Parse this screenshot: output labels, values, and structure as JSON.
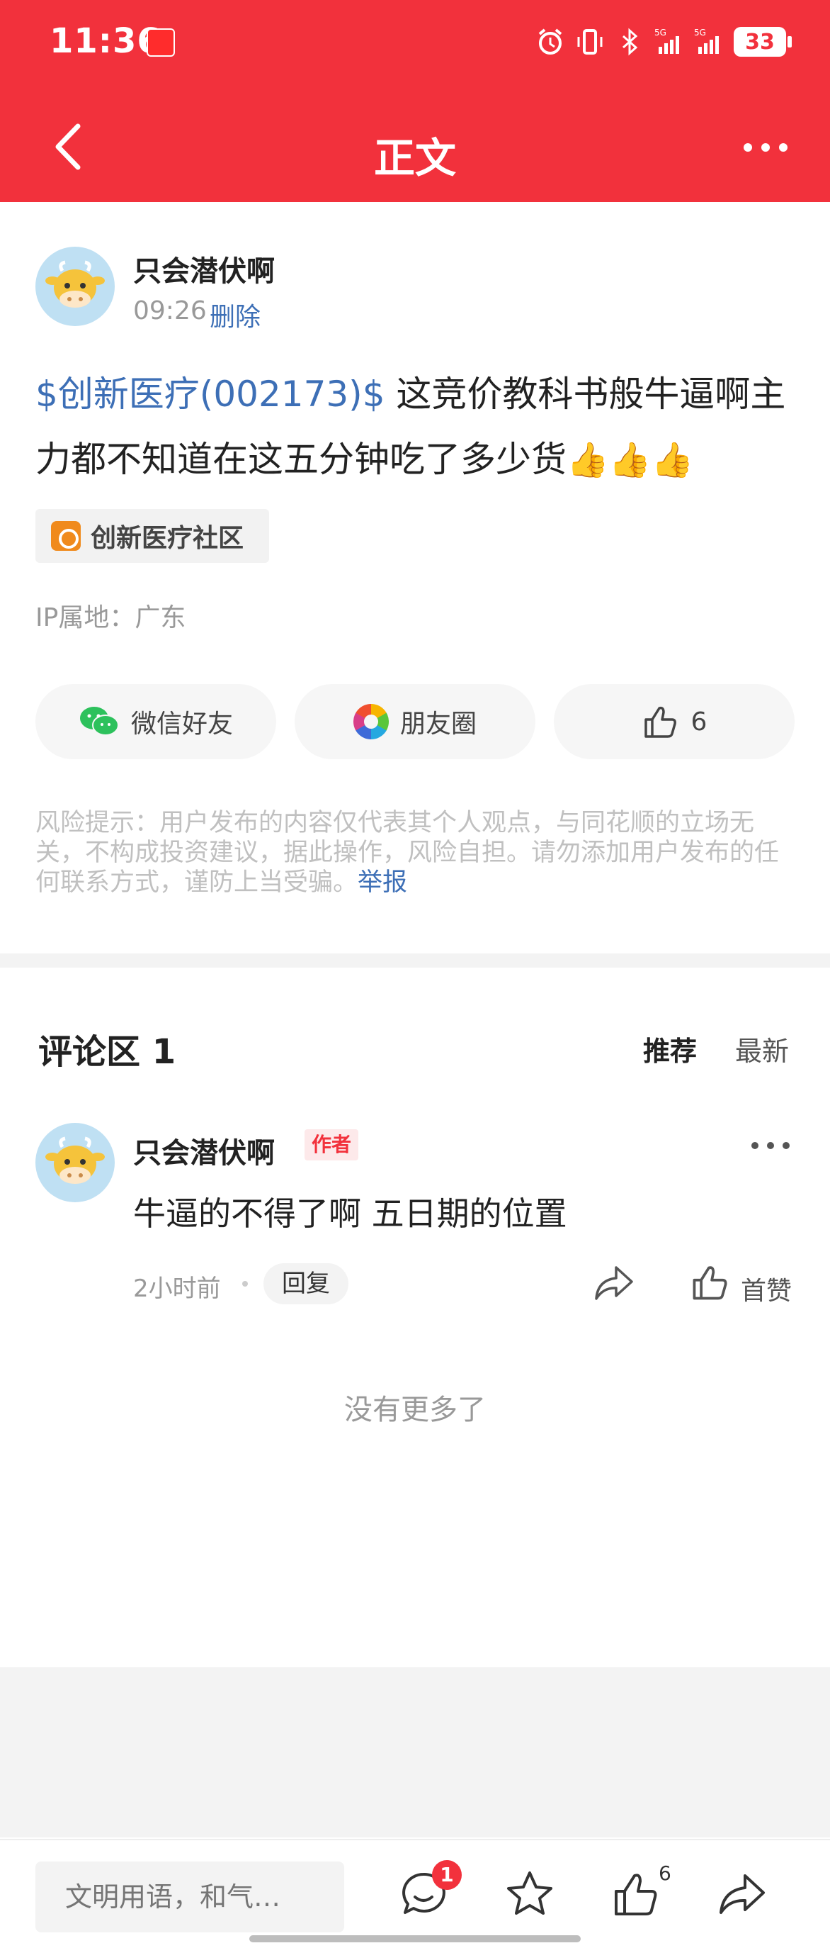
{
  "status_bar": {
    "time": "11:36",
    "battery": "33",
    "network": "5G"
  },
  "header": {
    "title": "正文"
  },
  "post": {
    "author": "只会潜伏啊",
    "time": "09:26",
    "delete_label": "删除",
    "stock_link": "$创新医疗(002173)$",
    "body_text": " 这竞价教科书般牛逼啊主力都不知道在这五分钟吃了多少货",
    "emoji": "👍👍👍",
    "community_tag": "创新医疗社区",
    "ip_location": "IP属地：广东",
    "share_wechat": "微信好友",
    "share_moments": "朋友圈",
    "like_count": "6"
  },
  "risk_note": {
    "text": "风险提示：用户发布的内容仅代表其个人观点，与同花顺的立场无关，不构成投资建议，据此操作，风险自担。请勿添加用户发布的任何联系方式，谨防上当受骗。",
    "report_link": "举报"
  },
  "comments": {
    "title": "评论区 1",
    "sort_recommend": "推荐",
    "sort_newest": "最新",
    "items": [
      {
        "author": "只会潜伏啊",
        "badge": "作者",
        "text": "牛逼的不得了啊 五日期的位置",
        "time": "2小时前",
        "reply_label": "回复",
        "like_label": "首赞"
      }
    ],
    "no_more": "没有更多了"
  },
  "bottom_bar": {
    "input_placeholder": "文明用语，和气…",
    "comment_badge": "1",
    "like_count": "6"
  },
  "colors": {
    "brand": "#f2313c",
    "link": "#3d6fb6"
  },
  "icons": [
    "back-arrow-icon",
    "more-icon",
    "wechat-icon",
    "moments-icon",
    "thumbs-up-icon",
    "share-icon",
    "comment-icon",
    "star-icon"
  ]
}
